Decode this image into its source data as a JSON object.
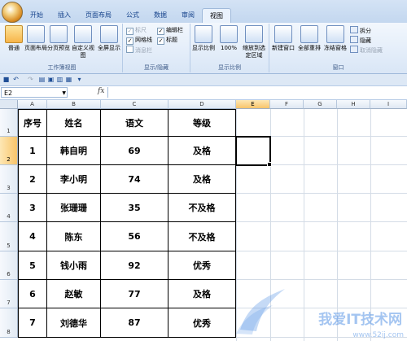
{
  "tabs": [
    "开始",
    "插入",
    "页面布局",
    "公式",
    "数据",
    "审阅",
    "视图"
  ],
  "active_tab": "视图",
  "ribbon": {
    "workbook_views": {
      "label": "工作簿视图",
      "buttons": [
        "普通",
        "页面布局",
        "分页预览",
        "自定义视图",
        "全屏显示"
      ]
    },
    "show_hide": {
      "label": "显示/隐藏",
      "items": [
        {
          "text": "标尺",
          "checked": true,
          "disabled": true
        },
        {
          "text": "网格线",
          "checked": true,
          "disabled": false
        },
        {
          "text": "消息栏",
          "checked": false,
          "disabled": true
        },
        {
          "text": "编辑栏",
          "checked": true,
          "disabled": false
        },
        {
          "text": "标题",
          "checked": true,
          "disabled": false
        }
      ]
    },
    "zoom": {
      "label": "显示比例",
      "buttons": [
        "显示比例",
        "100%",
        "缩放到选定区域"
      ]
    },
    "window": {
      "label": "窗口",
      "buttons": [
        "新建窗口",
        "全部重排",
        "冻结窗格"
      ],
      "small": [
        {
          "text": "拆分",
          "disabled": false
        },
        {
          "text": "隐藏",
          "disabled": false
        },
        {
          "text": "取消隐藏",
          "disabled": true
        }
      ]
    }
  },
  "formula_bar": {
    "name_box": "E2",
    "fx": "fx",
    "formula": ""
  },
  "columns": [
    "A",
    "B",
    "C",
    "D",
    "E",
    "F",
    "G",
    "H",
    "I"
  ],
  "selected_column": "E",
  "rows": [
    "1",
    "2",
    "3",
    "4",
    "5",
    "6",
    "7",
    "8"
  ],
  "selected_row": "2",
  "table": {
    "headers": [
      "序号",
      "姓名",
      "语文",
      "等级"
    ],
    "rows": [
      [
        "1",
        "韩自明",
        "69",
        "及格"
      ],
      [
        "2",
        "李小明",
        "74",
        "及格"
      ],
      [
        "3",
        "张珊珊",
        "35",
        "不及格"
      ],
      [
        "4",
        "陈东",
        "56",
        "不及格"
      ],
      [
        "5",
        "钱小雨",
        "92",
        "优秀"
      ],
      [
        "6",
        "赵敏",
        "77",
        "及格"
      ],
      [
        "7",
        "刘德华",
        "87",
        "优秀"
      ]
    ]
  },
  "watermark": {
    "title": "我爱IT技术网",
    "url": "www.52ij.com"
  }
}
